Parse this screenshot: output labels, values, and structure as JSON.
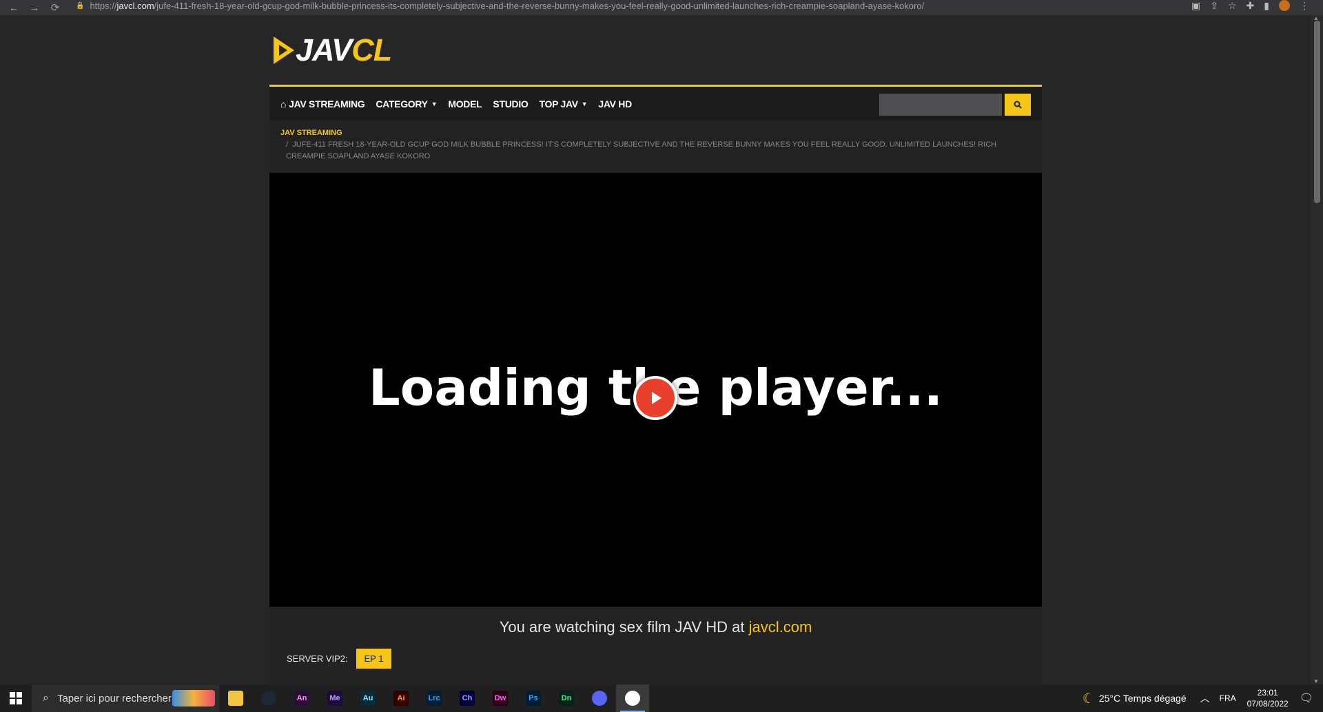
{
  "browser": {
    "url_prefix": "https://",
    "url_host": "javcl.com",
    "url_path": "/jufe-411-fresh-18-year-old-gcup-god-milk-bubble-princess-its-completely-subjective-and-the-reverse-bunny-makes-you-feel-really-good-unlimited-launches-rich-creampie-soapland-ayase-kokoro/"
  },
  "logo": {
    "part1": "JAV",
    "part2": "CL"
  },
  "nav": {
    "items": [
      {
        "label": "JAV STREAMING",
        "icon": "home-icon"
      },
      {
        "label": "CATEGORY",
        "dropdown": true
      },
      {
        "label": "MODEL"
      },
      {
        "label": "STUDIO"
      },
      {
        "label": "TOP JAV",
        "dropdown": true
      },
      {
        "label": "JAV HD"
      }
    ],
    "search_placeholder": ""
  },
  "breadcrumb": {
    "home": "JAV STREAMING",
    "separator": "/",
    "current": "JUFE-411 FRESH 18-YEAR-OLD GCUP GOD MILK BUBBLE PRINCESS! IT'S COMPLETELY SUBJECTIVE AND THE REVERSE BUNNY MAKES YOU FEEL REALLY GOOD. UNLIMITED LAUNCHES! RICH CREAMPIE SOAPLAND AYASE KOKORO"
  },
  "player": {
    "loading_text": "Loading the player..."
  },
  "info": {
    "watching_prefix": "You are watching sex film JAV HD at ",
    "watching_site": "javcl.com",
    "server_label": "SERVER VIP2:",
    "episode_label": "EP 1"
  },
  "taskbar": {
    "search_placeholder": "Taper ici pour rechercher",
    "apps": [
      {
        "name": "file-explorer",
        "label": "",
        "bg": "#f3c543",
        "fg": "#333"
      },
      {
        "name": "steam",
        "label": "",
        "bg": "#1b2838",
        "fg": "#fff"
      },
      {
        "name": "animate",
        "label": "An",
        "bg": "#2a0d3b",
        "fg": "#ff9ae6"
      },
      {
        "name": "media-encoder",
        "label": "Me",
        "bg": "#1f0b3b",
        "fg": "#b5a0ff"
      },
      {
        "name": "audition",
        "label": "Au",
        "bg": "#082a3b",
        "fg": "#8ae8ff"
      },
      {
        "name": "illustrator",
        "label": "Ai",
        "bg": "#330000",
        "fg": "#ff9a00"
      },
      {
        "name": "lightroom-classic",
        "label": "Lrc",
        "bg": "#001e36",
        "fg": "#31a8ff"
      },
      {
        "name": "character-animator",
        "label": "Ch",
        "bg": "#02003b",
        "fg": "#a89cff"
      },
      {
        "name": "dreamweaver",
        "label": "Dw",
        "bg": "#2c0018",
        "fg": "#ff61f6"
      },
      {
        "name": "photoshop",
        "label": "Ps",
        "bg": "#001e36",
        "fg": "#31a8ff"
      },
      {
        "name": "dimension",
        "label": "Dn",
        "bg": "#02241b",
        "fg": "#48e78d"
      },
      {
        "name": "discord",
        "label": "",
        "bg": "#5865f2",
        "fg": "#fff"
      },
      {
        "name": "chrome",
        "label": "",
        "bg": "#ffffff",
        "fg": "#000",
        "active": true
      }
    ],
    "weather": "25°C  Temps dégagé",
    "lang": "FRA",
    "time": "23:01",
    "date": "07/08/2022"
  }
}
